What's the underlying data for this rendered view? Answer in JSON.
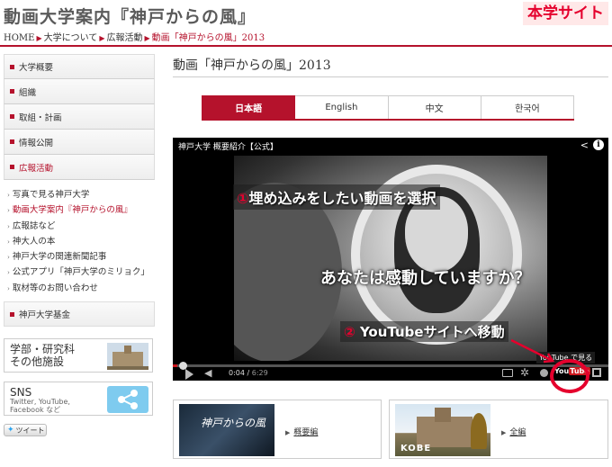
{
  "header": {
    "site_title": "動画大学案内『神戸からの風』",
    "badge": "本学サイト"
  },
  "breadcrumb": {
    "items": [
      "HOME",
      "大学について",
      "広報活動"
    ],
    "current": "動画「神戸からの風」2013"
  },
  "sidebar": {
    "top_items": [
      {
        "label": "大学概要"
      },
      {
        "label": "組織"
      },
      {
        "label": "取組・計画"
      },
      {
        "label": "情報公開"
      },
      {
        "label": "広報活動"
      }
    ],
    "sub_items": [
      {
        "label": "写真で見る神戸大学"
      },
      {
        "label": "動画大学案内『神戸からの風』"
      },
      {
        "label": "広報誌など"
      },
      {
        "label": "神大人の本"
      },
      {
        "label": "神戸大学の関連新聞記事"
      },
      {
        "label": "公式アプリ「神戸大学のミリョク」"
      },
      {
        "label": "取材等のお問い合わせ"
      }
    ],
    "fund_item": "神戸大学基金",
    "banner_facilities": {
      "line1": "学部・研究科",
      "line2": "その他施設"
    },
    "banner_sns": {
      "title": "SNS",
      "line1": "Twitter, YouTube,",
      "line2": "Facebook など"
    },
    "tweet_label": "ツイート"
  },
  "main": {
    "page_title": "動画「神戸からの風」2013",
    "lang_tabs": [
      {
        "label": "日本語",
        "active": true
      },
      {
        "label": "English",
        "active": false
      },
      {
        "label": "中文",
        "active": false
      },
      {
        "label": "한국어",
        "active": false
      }
    ]
  },
  "player": {
    "video_title": "神戸大学 概要紹介【公式】",
    "caption": "あなたは感動していますか？",
    "current_time": "0:04",
    "duration": "6:29",
    "progress": 0.01,
    "yt_logo_you": "You",
    "yt_logo_tube": "Tube",
    "tooltip": "YouTube で見る"
  },
  "annotations": {
    "step1_num": "①",
    "step1_text": "埋め込みをしたい動画を選択",
    "step2_num": "②",
    "step2_text": "YouTubeサイトへ移動",
    "accent_color": "#e5002d"
  },
  "thumbnails": [
    {
      "image_title": "神戸からの風",
      "image_subtitle": "",
      "link": "概要編"
    },
    {
      "image_title": "KOBE",
      "link": "全編"
    }
  ],
  "colors": {
    "brand": "#b5122c",
    "youtube_red": "#cc181e"
  }
}
